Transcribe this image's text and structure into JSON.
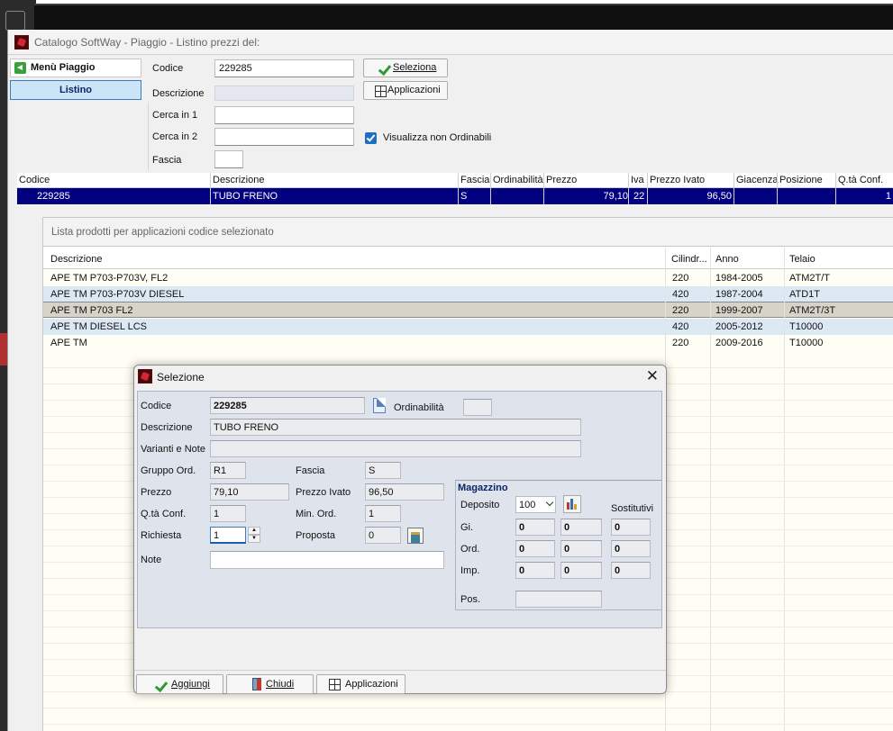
{
  "window": {
    "title": "Catalogo SoftWay - Piaggio - Listino prezzi del:"
  },
  "sidebar": {
    "menu_label": "Menù Piaggio",
    "listino_label": "Listino"
  },
  "search": {
    "codice_label": "Codice",
    "codice_value": "229285",
    "descrizione_label": "Descrizione",
    "descrizione_value": "",
    "cerca1_label": "Cerca in 1",
    "cerca1_value": "",
    "cerca2_label": "Cerca in 2",
    "cerca2_value": "",
    "fascia_label": "Fascia",
    "fascia_value": "",
    "seleziona_label": "Seleziona",
    "applicazioni_label": "Applicazioni",
    "checkbox_label": "Visualizza non Ordinabili",
    "checkbox_checked": true
  },
  "grid": {
    "headers": [
      "Codice",
      "Descrizione",
      "Fascia",
      "Ordinabilità",
      "Prezzo",
      "Iva",
      "Prezzo Ivato",
      "Giacenza",
      "Posizione",
      "Q.tà Conf."
    ],
    "row": {
      "codice": "229285",
      "descrizione": "TUBO FRENO",
      "fascia": "S",
      "ordinabilita": "",
      "prezzo": "79,10",
      "iva": "22",
      "prezzo_ivato": "96,50",
      "giacenza": "",
      "posizione": "",
      "qta_conf": "1"
    }
  },
  "lista": {
    "title": "Lista prodotti per applicazioni codice selezionato",
    "headers": [
      "Descrizione",
      "Cilindr...",
      "Anno",
      "Telaio"
    ],
    "rows": [
      {
        "descrizione": "APE TM P703-P703V, FL2",
        "cilindrata": "220",
        "anno": "1984-2005",
        "telaio": "ATM2T/T"
      },
      {
        "descrizione": "APE TM P703-P703V DIESEL",
        "cilindrata": "420",
        "anno": "1987-2004",
        "telaio": "ATD1T"
      },
      {
        "descrizione": "APE TM P703 FL2",
        "cilindrata": "220",
        "anno": "1999-2007",
        "telaio": "ATM2T/3T"
      },
      {
        "descrizione": "APE TM DIESEL LCS",
        "cilindrata": "420",
        "anno": "2005-2012",
        "telaio": "T10000"
      },
      {
        "descrizione": "APE TM",
        "cilindrata": "220",
        "anno": "2009-2016",
        "telaio": "T10000"
      }
    ]
  },
  "dialog": {
    "title": "Selezione",
    "codice_label": "Codice",
    "codice_value": "229285",
    "ordinabilita_label": "Ordinabilità",
    "ordinabilita_value": "",
    "descrizione_label": "Descrizione",
    "descrizione_value": "TUBO FRENO",
    "varianti_label": "Varianti e Note",
    "varianti_value": "",
    "gruppo_label": "Gruppo Ord.",
    "gruppo_value": "R1",
    "fascia_label": "Fascia",
    "fascia_value": "S",
    "prezzo_label": "Prezzo",
    "prezzo_value": "79,10",
    "prezzo_ivato_label": "Prezzo Ivato",
    "prezzo_ivato_value": "96,50",
    "qta_conf_label": "Q.tà Conf.",
    "qta_conf_value": "1",
    "min_ord_label": "Min. Ord.",
    "min_ord_value": "1",
    "richiesta_label": "Richiesta",
    "richiesta_value": "1",
    "proposta_label": "Proposta",
    "proposta_value": "0",
    "note_label": "Note",
    "note_value": "",
    "magazzino": {
      "title": "Magazzino",
      "deposito_label": "Deposito",
      "deposito_value": "100",
      "sostitutivi_label": "Sostitutivi",
      "gi_label": "Gi.",
      "ord_label": "Ord.",
      "imp_label": "Imp.",
      "pos_label": "Pos.",
      "gi_values": [
        "0",
        "0",
        "0"
      ],
      "ord_values": [
        "0",
        "0",
        "0"
      ],
      "imp_values": [
        "0",
        "0",
        "0"
      ],
      "pos_value": ""
    },
    "buttons": {
      "aggiungi": "Aggiungi",
      "chiudi": "Chiudi",
      "applicazioni": "Applicazioni"
    }
  }
}
